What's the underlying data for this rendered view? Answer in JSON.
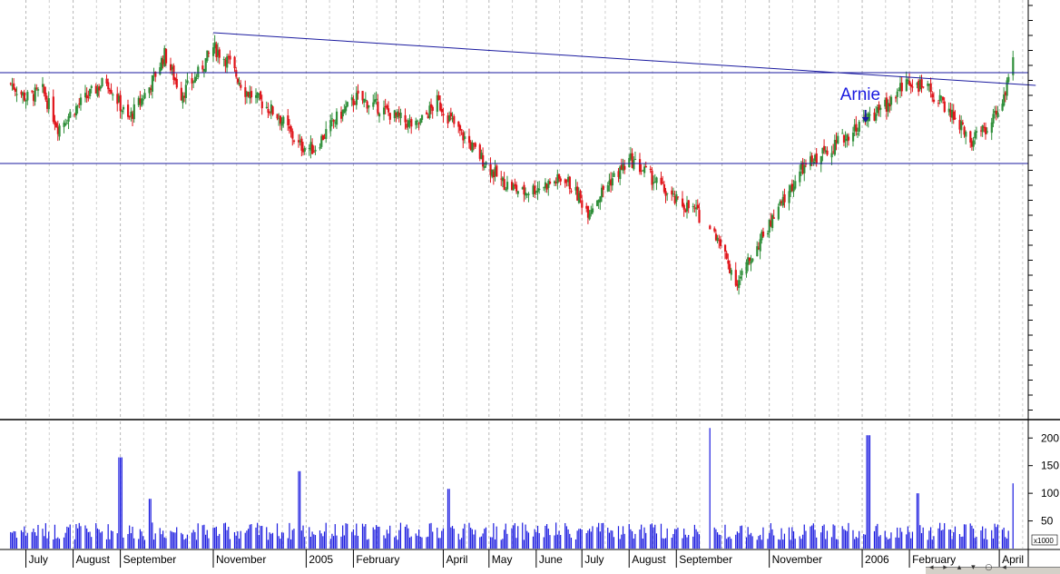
{
  "chart_data": [
    {
      "type": "candlestick",
      "xlabel": "",
      "ylabel": "",
      "month_labels": [
        "July",
        "August",
        "September",
        "November",
        "2005",
        "February",
        "April",
        "May",
        "June",
        "July",
        "August",
        "September",
        "November",
        "2006",
        "February",
        "April"
      ],
      "grid": "vertical dashed",
      "price_range": [
        0,
        100
      ],
      "lines": {
        "support": 60,
        "resistance": 85,
        "trendline": [
          {
            "x": "2004-11-01",
            "y": 96
          },
          {
            "x": "2006-04-10",
            "y": 82
          }
        ]
      },
      "close_series": [
        {
          "date": "2004-06-21",
          "close": 82
        },
        {
          "date": "2004-07-01",
          "close": 78
        },
        {
          "date": "2004-07-12",
          "close": 80
        },
        {
          "date": "2004-07-22",
          "close": 70
        },
        {
          "date": "2004-08-02",
          "close": 75
        },
        {
          "date": "2004-08-12",
          "close": 79
        },
        {
          "date": "2004-08-23",
          "close": 83
        },
        {
          "date": "2004-09-06",
          "close": 72
        },
        {
          "date": "2004-09-20",
          "close": 81
        },
        {
          "date": "2004-09-30",
          "close": 90
        },
        {
          "date": "2004-10-11",
          "close": 79
        },
        {
          "date": "2004-10-21",
          "close": 84
        },
        {
          "date": "2004-11-01",
          "close": 92
        },
        {
          "date": "2004-11-11",
          "close": 88
        },
        {
          "date": "2004-11-22",
          "close": 80
        },
        {
          "date": "2004-12-02",
          "close": 77
        },
        {
          "date": "2004-12-14",
          "close": 73
        },
        {
          "date": "2004-12-27",
          "close": 65
        },
        {
          "date": "2005-01-06",
          "close": 64
        },
        {
          "date": "2005-01-20",
          "close": 72
        },
        {
          "date": "2005-02-03",
          "close": 78
        },
        {
          "date": "2005-02-15",
          "close": 76
        },
        {
          "date": "2005-02-28",
          "close": 73
        },
        {
          "date": "2005-03-14",
          "close": 70
        },
        {
          "date": "2005-03-28",
          "close": 77
        },
        {
          "date": "2005-04-11",
          "close": 69
        },
        {
          "date": "2005-04-25",
          "close": 62
        },
        {
          "date": "2005-05-09",
          "close": 55
        },
        {
          "date": "2005-05-23",
          "close": 52
        },
        {
          "date": "2005-06-06",
          "close": 54
        },
        {
          "date": "2005-06-20",
          "close": 56
        },
        {
          "date": "2005-07-05",
          "close": 47
        },
        {
          "date": "2005-07-19",
          "close": 55
        },
        {
          "date": "2005-08-02",
          "close": 61
        },
        {
          "date": "2005-08-16",
          "close": 56
        },
        {
          "date": "2005-08-30",
          "close": 50
        },
        {
          "date": "2005-09-13",
          "close": 47
        },
        {
          "date": "2005-09-27",
          "close": 40
        },
        {
          "date": "2005-10-11",
          "close": 27
        },
        {
          "date": "2005-10-25",
          "close": 38
        },
        {
          "date": "2005-11-08",
          "close": 48
        },
        {
          "date": "2005-11-22",
          "close": 58
        },
        {
          "date": "2005-12-06",
          "close": 63
        },
        {
          "date": "2005-12-20",
          "close": 67
        },
        {
          "date": "2006-01-03",
          "close": 72
        },
        {
          "date": "2006-01-17",
          "close": 76
        },
        {
          "date": "2006-01-31",
          "close": 83
        },
        {
          "date": "2006-02-14",
          "close": 80
        },
        {
          "date": "2006-02-28",
          "close": 74
        },
        {
          "date": "2006-03-14",
          "close": 66
        },
        {
          "date": "2006-03-28",
          "close": 72
        },
        {
          "date": "2006-04-07",
          "close": 82
        },
        {
          "date": "2006-04-10",
          "close": 88
        }
      ],
      "annotation": {
        "text": "Arnie",
        "date": "2006-01-02",
        "arrow": "down"
      }
    },
    {
      "type": "bar",
      "name": "volume",
      "unit_label": "x1000",
      "ylim": [
        0,
        230
      ],
      "y_ticks": [
        "50",
        "100",
        "150",
        "200"
      ],
      "baseline_volume": 35,
      "spikes": [
        {
          "date": "2004-09-01",
          "value": 165
        },
        {
          "date": "2004-09-20",
          "value": 90
        },
        {
          "date": "2004-12-27",
          "value": 140
        },
        {
          "date": "2005-04-04",
          "value": 108
        },
        {
          "date": "2005-09-23",
          "value": 218
        },
        {
          "date": "2006-01-05",
          "value": 205
        },
        {
          "date": "2006-02-06",
          "value": 100
        },
        {
          "date": "2006-04-10",
          "value": 118
        }
      ]
    }
  ],
  "status_icons": [
    "first-icon",
    "prev-icon",
    "zoom-in-icon",
    "zoom-out-icon",
    "search-icon",
    "next-icon"
  ],
  "colors": {
    "up": "#2f8f3a",
    "down": "#e0141a",
    "line": "#1a1a9f",
    "volume": "#1a1adf"
  }
}
